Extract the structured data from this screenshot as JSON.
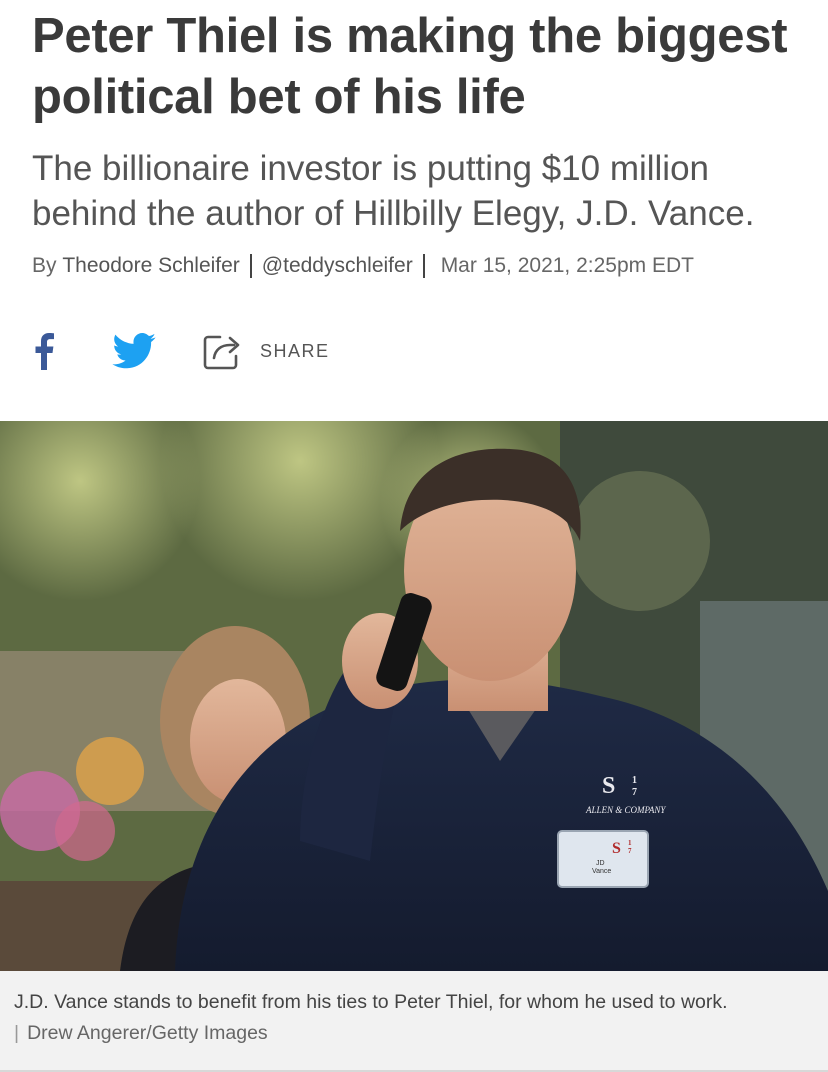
{
  "article": {
    "headline": "Peter Thiel is making the biggest political bet of his life",
    "dek": "The billionaire investor is putting $10 million behind the author of Hillbilly Elegy, J.D. Vance.",
    "byline_prefix": "By",
    "author": "Theodore Schleifer",
    "author_handle": "@teddyschleifer",
    "date": "Mar 15, 2021, 2:25pm EDT"
  },
  "social": {
    "share_label": "SHARE",
    "icons": [
      "facebook-icon",
      "twitter-icon",
      "share-icon"
    ],
    "facebook_color": "#3b5998",
    "twitter_color": "#1da1f2"
  },
  "photo": {
    "jacket_logo": "S",
    "jacket_logo_sup": "1",
    "jacket_logo_sub": "7",
    "jacket_brand": "ALLEN & COMPANY",
    "badge_first": "JD",
    "badge_last": "Vance",
    "badge_logo": "S",
    "badge_logo_sup": "1",
    "badge_logo_sub": "7"
  },
  "caption": {
    "text": "J.D. Vance stands to benefit from his ties to Peter Thiel, for whom he used to work.",
    "credit": "Drew Angerer/Getty Images"
  }
}
